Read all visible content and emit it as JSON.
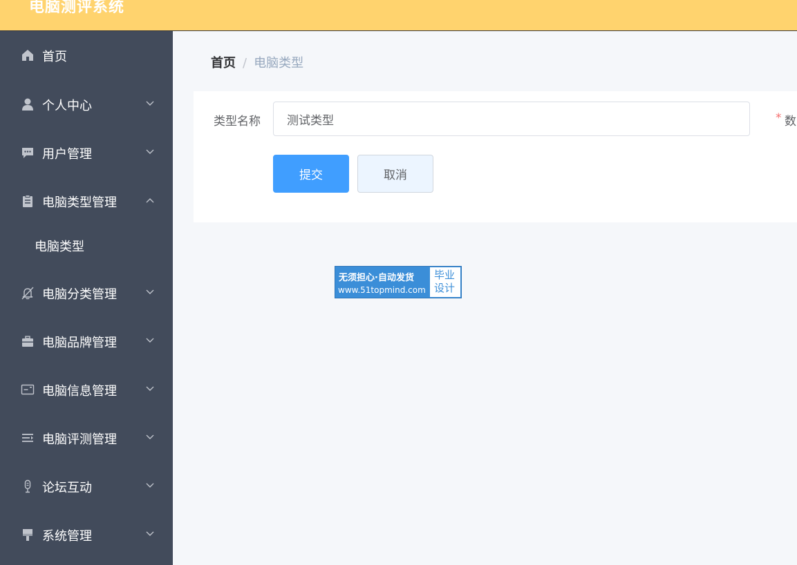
{
  "app": {
    "title": "电脑测评系统"
  },
  "sidebar": {
    "items": [
      {
        "label": "首页",
        "icon": "home-icon",
        "expandable": false
      },
      {
        "label": "个人中心",
        "icon": "user-icon",
        "expandable": true,
        "expanded": false
      },
      {
        "label": "用户管理",
        "icon": "chat-bubble-icon",
        "expandable": true,
        "expanded": false
      },
      {
        "label": "电脑类型管理",
        "icon": "clipboard-icon",
        "expandable": true,
        "expanded": true
      },
      {
        "label": "电脑分类管理",
        "icon": "bell-off-icon",
        "expandable": true,
        "expanded": false
      },
      {
        "label": "电脑品牌管理",
        "icon": "briefcase-icon",
        "expandable": true,
        "expanded": false
      },
      {
        "label": "电脑信息管理",
        "icon": "id-card-icon",
        "expandable": true,
        "expanded": false
      },
      {
        "label": "电脑评测管理",
        "icon": "list-indent-icon",
        "expandable": true,
        "expanded": false
      },
      {
        "label": "论坛互动",
        "icon": "microphone-icon",
        "expandable": true,
        "expanded": false
      },
      {
        "label": "系统管理",
        "icon": "brush-icon",
        "expandable": true,
        "expanded": false
      }
    ],
    "sub_item": {
      "label": "电脑类型"
    }
  },
  "breadcrumb": {
    "home": "首页",
    "separator": "/",
    "current": "电脑类型"
  },
  "form": {
    "type_name_label": "类型名称",
    "type_name_value": "测试类型",
    "required_mark": "*",
    "second_field_label": "数",
    "submit_label": "提交",
    "cancel_label": "取消"
  },
  "watermark": {
    "line1": "无须担心·自动发货",
    "line2": "www.51topmind.com",
    "badge_line1": "毕业",
    "badge_line2": "设计"
  },
  "colors": {
    "topbar": "#ffd36e",
    "sidebar": "#424b5b",
    "primary": "#409eff",
    "content_bg": "#f5f7fa"
  }
}
